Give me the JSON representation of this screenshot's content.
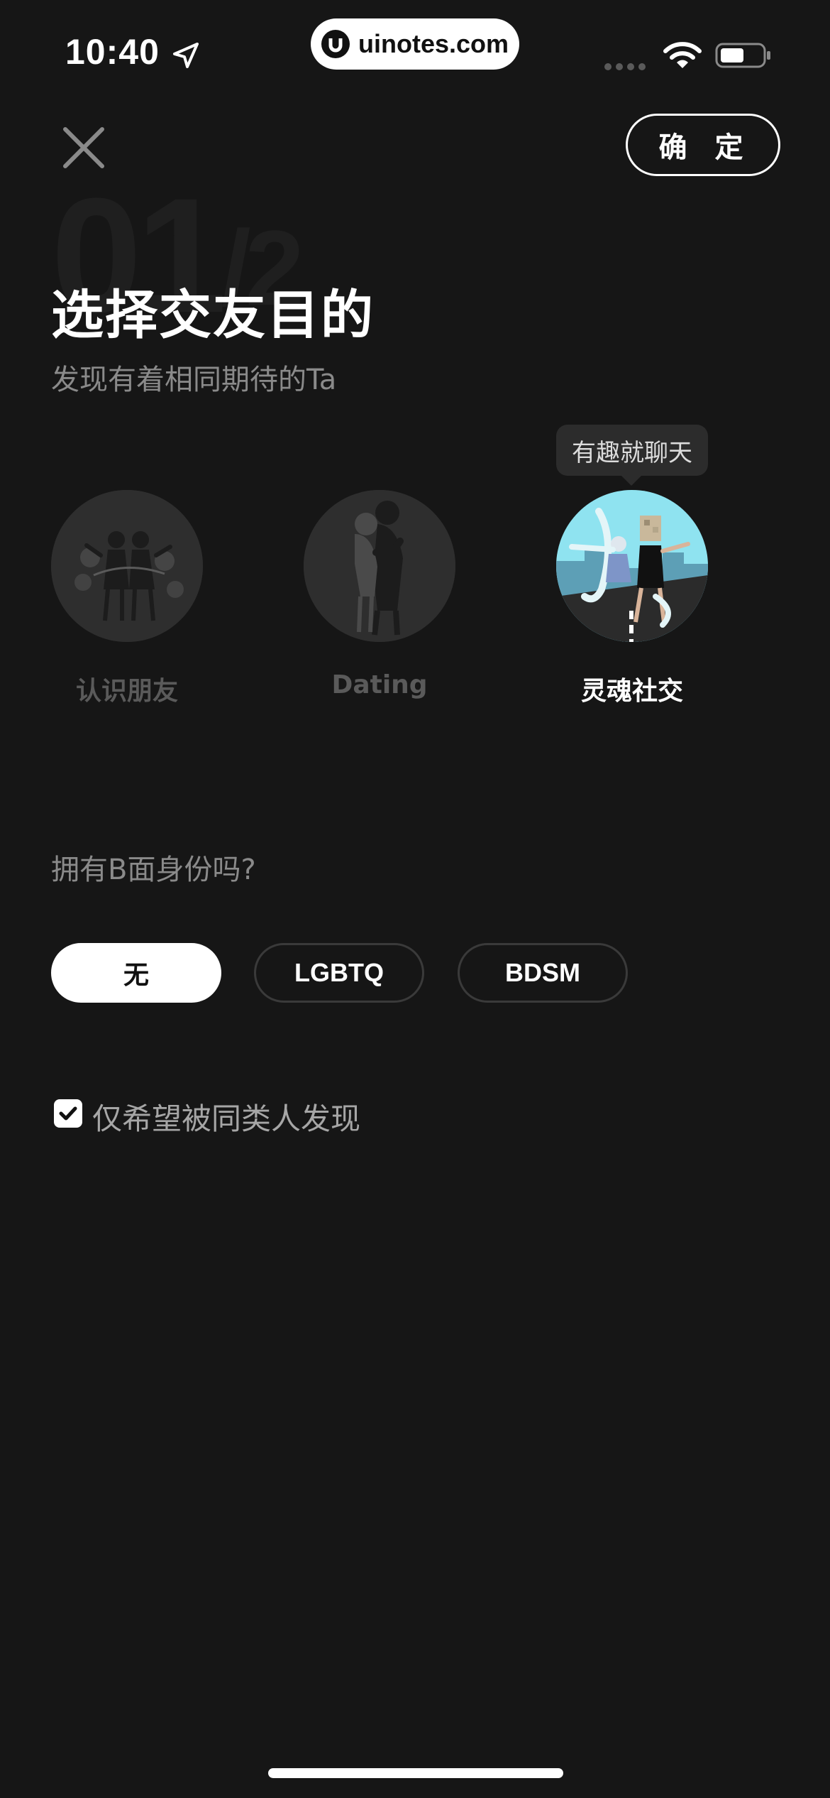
{
  "status_bar": {
    "time": "10:40",
    "watermark": "uinotes.com",
    "icons": [
      "location-arrow-icon",
      "cellular-signal-icon",
      "wifi-icon",
      "battery-icon"
    ]
  },
  "header": {
    "close_icon": "close-icon",
    "confirm_label": "确 定"
  },
  "step": {
    "current": "01",
    "total": "2"
  },
  "title": "选择交友目的",
  "subtitle": "发现有着相同期待的Ta",
  "purposes": [
    {
      "label": "认识朋友",
      "selected": false
    },
    {
      "label": "Dating",
      "selected": false
    },
    {
      "label": "灵魂社交",
      "selected": true,
      "tooltip": "有趣就聊天"
    }
  ],
  "identity": {
    "question": "拥有B面身份吗?",
    "options": [
      {
        "label": "无",
        "selected": true
      },
      {
        "label": "LGBTQ",
        "selected": false
      },
      {
        "label": "BDSM",
        "selected": false
      }
    ]
  },
  "filter": {
    "checked": true,
    "label": "仅希望被同类人发现"
  },
  "colors": {
    "background": "#161616",
    "selected_chip": "#ffffff",
    "muted_text": "#8a8a8a",
    "accent_sky": "#8fe3f0"
  }
}
